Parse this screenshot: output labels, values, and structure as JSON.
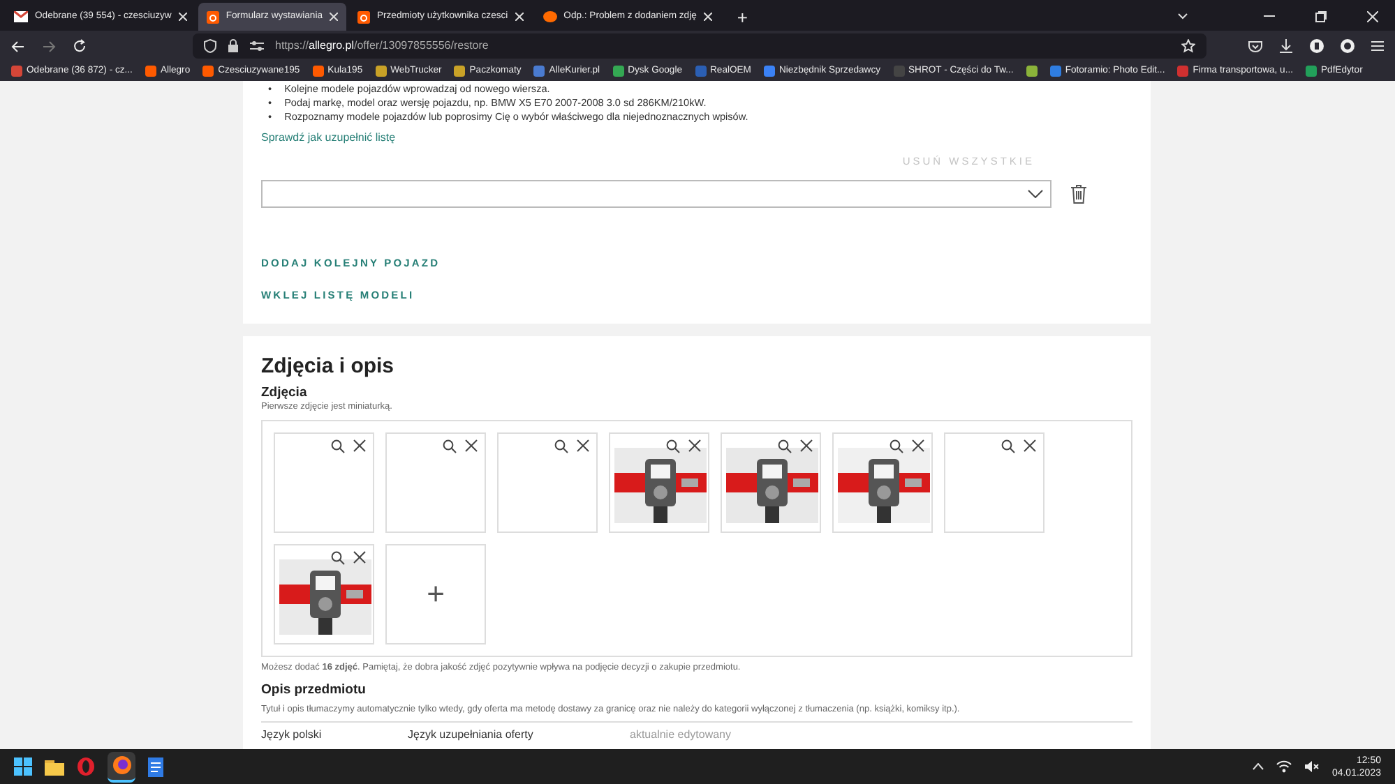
{
  "browser": {
    "tabs": [
      {
        "title": "Odebrane (39 554) - czesciuzyw",
        "selected": false
      },
      {
        "title": "Formularz wystawiania",
        "selected": true
      },
      {
        "title": "Przedmioty użytkownika czesci",
        "selected": false
      },
      {
        "title": "Odp.: Problem z dodaniem zdję",
        "selected": false
      }
    ],
    "new_tab_symbol": "+",
    "url": {
      "prefix": "https://",
      "domain": "allegro.pl",
      "path": "/offer/13097855556/restore"
    },
    "bookmarks": [
      {
        "label": "Odebrane (36 872) - cz...",
        "color": "#d44638"
      },
      {
        "label": "Allegro",
        "color": "#ff5a00"
      },
      {
        "label": "Czesciuzywane195",
        "color": "#ff5a00"
      },
      {
        "label": "Kula195",
        "color": "#ff5a00"
      },
      {
        "label": "WebTrucker",
        "color": "#c9a227"
      },
      {
        "label": "Paczkomaty",
        "color": "#c9a227"
      },
      {
        "label": "AlleKurier.pl",
        "color": "#4a7bd0"
      },
      {
        "label": "Dysk Google",
        "color": "#34a853"
      },
      {
        "label": "RealOEM",
        "color": "#2b5fb4"
      },
      {
        "label": "Niezbędnik Sprzedawcy",
        "color": "#3b82f6"
      },
      {
        "label": "SHROT - Części do Tw...",
        "color": "#444444"
      },
      {
        "color": "#8bb33a"
      },
      {
        "label": "Fotoramio: Photo Edit...",
        "color": "#2f7de1"
      },
      {
        "label": "Firma transportowa, u...",
        "color": "#d03030"
      },
      {
        "label": "PdfEdytor",
        "color": "#22a05a"
      }
    ]
  },
  "vehicles": {
    "bullets": [
      {
        "marker": "•",
        "text": "Kolejne modele pojazdów wprowadzaj od nowego wiersza."
      },
      {
        "marker": "•",
        "text": "Podaj markę, model oraz wersję pojazdu, np. BMW X5 E70 2007-2008 3.0 sd 286KM/210kW."
      },
      {
        "marker": "•",
        "text": "Rozpoznamy modele pojazdów lub poprosimy Cię o wybór właściwego dla niejednoznacznych wpisów."
      }
    ],
    "help_link": "Sprawdź jak uzupełnić listę",
    "remove_all": "USUŃ WSZYSTKIE",
    "add_vehicle": "DODAJ KOLEJNY POJAZD",
    "paste_list": "WKLEJ LISTĘ MODELI"
  },
  "photos_section": {
    "title": "Zdjęcia i opis",
    "photos_heading": "Zdjęcia",
    "photos_hint": "Pierwsze zdjęcie jest miniaturką.",
    "photos": [
      {
        "kind": "empty"
      },
      {
        "kind": "empty"
      },
      {
        "kind": "empty"
      },
      {
        "kind": "picture"
      },
      {
        "kind": "picture"
      },
      {
        "kind": "picture"
      },
      {
        "kind": "empty"
      },
      {
        "kind": "picture"
      }
    ],
    "add_symbol": "+",
    "limit_note": "Możesz dodać **16 zdjęć**. Pamiętaj, że dobra jakość zdjęć pozytywnie wpływa na podjęcie decyzji o zakupie przedmiotu.",
    "description_heading": "Opis przedmiotu",
    "translation_note": "Tytuł i opis tłumaczymy automatycznie tylko wtedy, gdy oferta ma metodę dostawy za granicę oraz nie należy do kategorii wyłączonej z tłumaczenia (np. książki, komiksy itp.).",
    "language_row": [
      "Język polski",
      "Język uzupełniania oferty",
      "aktualnie edytowany"
    ]
  },
  "taskbar": {
    "time": "12:50",
    "date": "04.01.2023"
  }
}
